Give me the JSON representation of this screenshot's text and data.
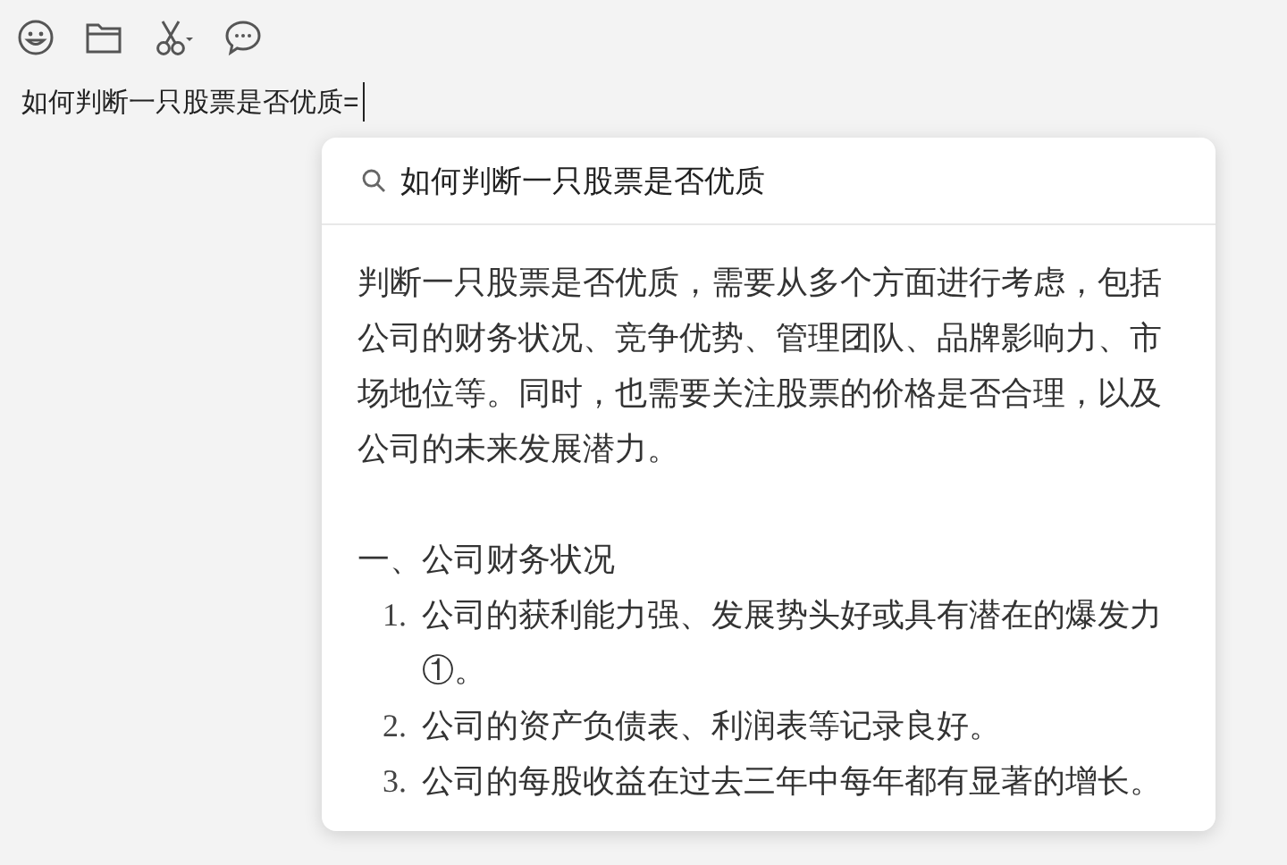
{
  "toolbar": {
    "icons": [
      {
        "kind": "emoji"
      },
      {
        "kind": "folder"
      },
      {
        "kind": "scissors"
      },
      {
        "kind": "chat"
      }
    ]
  },
  "input": {
    "value": "如何判断一只股票是否优质="
  },
  "popup": {
    "query": "如何判断一只股票是否优质",
    "paragraph": "判断一只股票是否优质，需要从多个方面进行考虑，包括公司的财务状况、竞争优势、管理团队、品牌影响力、市场地位等。同时，也需要关注股票的价格是否合理，以及公司的未来发展潜力。",
    "heading": "一、公司财务状况",
    "list": [
      {
        "number": "1.",
        "text": "公司的获利能力强、发展势头好或具有潜在的爆发力①。"
      },
      {
        "number": "2.",
        "text": "公司的资产负债表、利润表等记录良好。"
      },
      {
        "number": "3.",
        "text": "公司的每股收益在过去三年中每年都有显著的增长。"
      }
    ]
  }
}
